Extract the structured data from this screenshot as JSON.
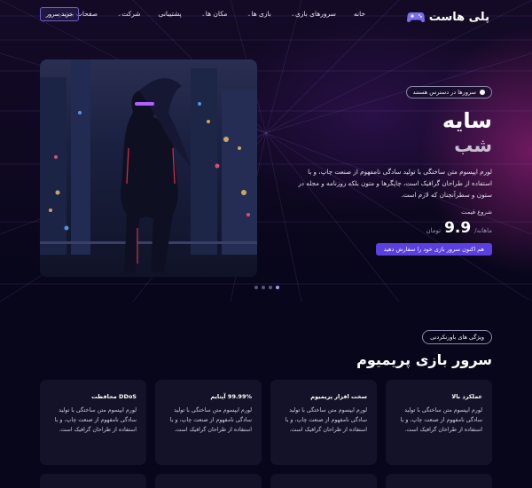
{
  "header": {
    "logo_text": "پلی هاست",
    "nav": [
      {
        "label": "خانه",
        "has_menu": false
      },
      {
        "label": "سرورهای بازی",
        "has_menu": true
      },
      {
        "label": "بازی ها",
        "has_menu": true
      },
      {
        "label": "مکان ها",
        "has_menu": true
      },
      {
        "label": "پشتیبانی",
        "has_menu": false
      },
      {
        "label": "شرکت",
        "has_menu": true
      },
      {
        "label": "صفحات بیشتر",
        "has_menu": true
      }
    ],
    "buy_button": "خرید سرور"
  },
  "hero": {
    "badge": "سرورها در دسترس هستند",
    "title": "سایه",
    "subtitle": "شب",
    "description": "لورم ایپسوم متن ساختگی با تولید سادگی نامفهوم از صنعت چاپ، و با استفاده از طراحان گرافیک است، چاپگرها و متون بلکه روزنامه و مجله در ستون و سطرآنچنان که لازم است.",
    "start_price_label": "شروع قیمت",
    "price_period": "ماهانه/",
    "price_value": "9.9",
    "price_currency": "تومان",
    "cta": "هم اکنون سرور بازی خود را سفارش دهید",
    "slides_total": 4,
    "slide_active": 4
  },
  "features": {
    "badge": "ویژگی های باورنکردنی",
    "title": "سرور بازی پریمیوم",
    "cards": [
      {
        "title": "عملکرد بالا",
        "description": "لورم ایپسوم متن ساختگی با تولید سادگی نامفهوم از صنعت چاپ، و با استفاده از طراحان گرافیک است."
      },
      {
        "title": "سخت افزار پریمیوم",
        "description": "لورم ایپسوم متن ساختگی با تولید سادگی نامفهوم از صنعت چاپ، و با استفاده از طراحان گرافیک است."
      },
      {
        "title": "99.99% آپتایم",
        "description": "لورم ایپسوم متن ساختگی با تولید سادگی نامفهوم از صنعت چاپ، و با استفاده از طراحان گرافیک است."
      },
      {
        "title": "DDoS محافظت",
        "description": "لورم ایپسوم متن ساختگی با تولید سادگی نامفهوم از صنعت چاپ، و با استفاده از طراحان گرافیک است."
      }
    ]
  },
  "colors": {
    "background": "#07061a",
    "accent": "#5b3fe0",
    "glow": "#be2896",
    "card": "#141228"
  }
}
